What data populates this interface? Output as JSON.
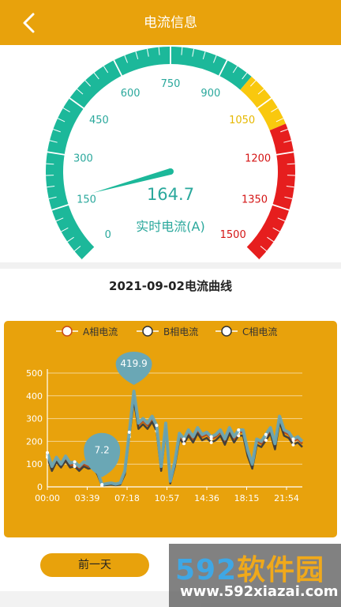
{
  "header": {
    "title": "电流信息"
  },
  "gauge": {
    "value": "164.7",
    "value_num": 164.7,
    "max": 1500,
    "label": "实时电流(A)",
    "ticks": [
      "0",
      "150",
      "300",
      "450",
      "600",
      "750",
      "900",
      "1050",
      "1200",
      "1350",
      "1500"
    ],
    "colors": {
      "normal": "#1CB89A",
      "warning": "#F9C80E",
      "danger": "#E61E1E",
      "normal_text": "#2AA89C",
      "warning_text": "#E6B800",
      "danger_text": "#D41414"
    }
  },
  "chart": {
    "title": "2021-09-02电流曲线",
    "legend": [
      "A相电流",
      "B相电流",
      "C相电流"
    ],
    "callouts": [
      "419.9",
      "7.2"
    ]
  },
  "chart_data": {
    "type": "line",
    "title": "2021-09-02电流曲线",
    "x_ticks": [
      "00:00",
      "03:39",
      "07:18",
      "10:57",
      "14:36",
      "18:15",
      "21:54"
    ],
    "y_ticks": [
      "0",
      "100",
      "200",
      "300",
      "400",
      "500"
    ],
    "ylim": [
      0,
      500
    ],
    "x": [
      "00:00",
      "00:30",
      "01:00",
      "01:30",
      "02:00",
      "02:30",
      "03:00",
      "03:39",
      "04:00",
      "04:30",
      "05:00",
      "05:30",
      "06:00",
      "06:30",
      "07:00",
      "07:18",
      "07:40",
      "08:00",
      "08:20",
      "08:40",
      "09:00",
      "09:20",
      "09:40",
      "10:00",
      "10:20",
      "10:40",
      "10:57",
      "11:20",
      "11:40",
      "12:00",
      "12:20",
      "12:40",
      "13:00",
      "13:20",
      "13:40",
      "14:00",
      "14:36",
      "15:00",
      "15:30",
      "16:00",
      "16:30",
      "17:00",
      "17:30",
      "18:15",
      "18:40",
      "19:00",
      "19:20",
      "19:40",
      "20:00",
      "20:20",
      "20:40",
      "21:00",
      "21:30",
      "21:54",
      "22:30",
      "23:00",
      "23:30"
    ],
    "series": [
      {
        "name": "A相电流",
        "values": [
          140,
          80,
          120,
          90,
          125,
          95,
          100,
          80,
          100,
          90,
          95,
          60,
          8,
          12,
          15,
          10,
          15,
          60,
          230,
          400,
          270,
          290,
          270,
          300,
          260,
          80,
          270,
          20,
          100,
          225,
          200,
          240,
          210,
          250,
          220,
          230,
          210,
          220,
          240,
          200,
          250,
          210,
          240,
          240,
          150,
          90,
          200,
          190,
          220,
          250,
          180,
          300,
          240,
          230,
          200,
          210,
          190
        ]
      },
      {
        "name": "B相电流",
        "values": [
          130,
          70,
          110,
          85,
          115,
          85,
          90,
          70,
          90,
          80,
          85,
          55,
          5,
          8,
          10,
          7,
          10,
          55,
          220,
          380,
          255,
          275,
          255,
          285,
          245,
          70,
          255,
          15,
          90,
          210,
          190,
          225,
          195,
          235,
          205,
          215,
          195,
          205,
          225,
          185,
          235,
          195,
          225,
          225,
          135,
          80,
          185,
          175,
          205,
          235,
          165,
          285,
          225,
          215,
          185,
          195,
          175
        ]
      },
      {
        "name": "C相电流",
        "values": [
          150,
          90,
          130,
          100,
          135,
          105,
          110,
          90,
          110,
          100,
          105,
          70,
          10,
          14,
          17,
          12,
          17,
          70,
          240,
          420,
          280,
          300,
          280,
          310,
          270,
          90,
          280,
          25,
          110,
          235,
          210,
          250,
          220,
          260,
          230,
          240,
          220,
          230,
          250,
          210,
          260,
          220,
          250,
          250,
          160,
          100,
          210,
          200,
          230,
          260,
          190,
          310,
          250,
          240,
          210,
          220,
          200
        ]
      }
    ]
  },
  "buttons": {
    "prev_day": "前一天"
  },
  "watermark": {
    "digits": "592",
    "cn": "软件园",
    "url": "www.592xiazai.com"
  }
}
